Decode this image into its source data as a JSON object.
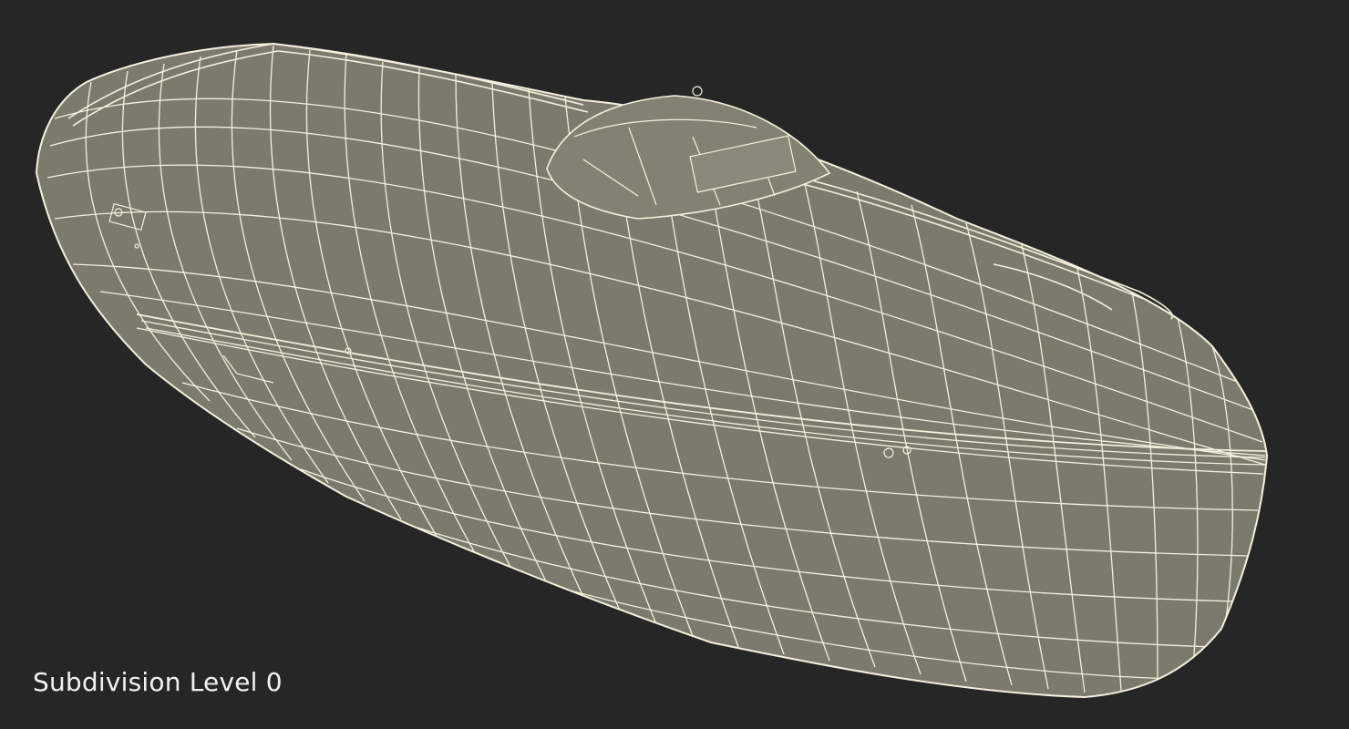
{
  "viewport": {
    "caption": "Subdivision Level 0",
    "background_color": "#262626",
    "model": {
      "subject": "lifeboat-hull-wireframe",
      "surface_color": "#7b7a6c",
      "wire_color": "#f4f0dc"
    }
  }
}
